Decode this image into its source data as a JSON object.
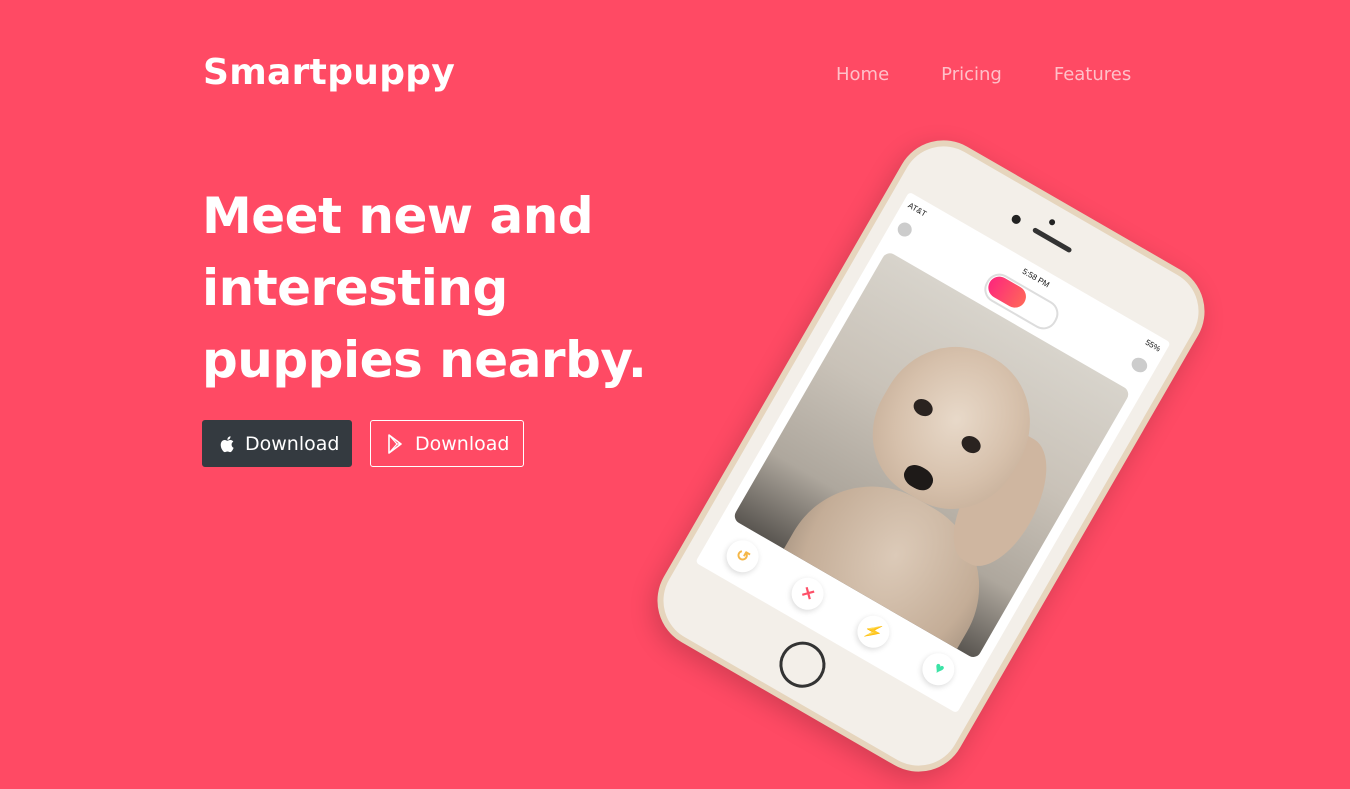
{
  "header": {
    "brand": "Smartpuppy",
    "nav": [
      "Home",
      "Pricing",
      "Features"
    ]
  },
  "hero": {
    "headline_lines": [
      "Meet new and",
      "interesting",
      "puppies nearby."
    ],
    "buttons": {
      "apple_label": "Download",
      "play_label": "Download"
    }
  },
  "phone": {
    "carrier": "AT&T",
    "time": "5:58 PM",
    "battery": "55%"
  },
  "colors": {
    "background": "#ff4a64",
    "apple_button": "#343a40",
    "text": "#ffffff"
  },
  "icons": {
    "apple_button_icon": "apple-icon",
    "play_button_icon": "google-play-icon",
    "phone_actions": [
      "rewind-icon",
      "close-icon",
      "boost-icon",
      "heart-icon"
    ]
  }
}
